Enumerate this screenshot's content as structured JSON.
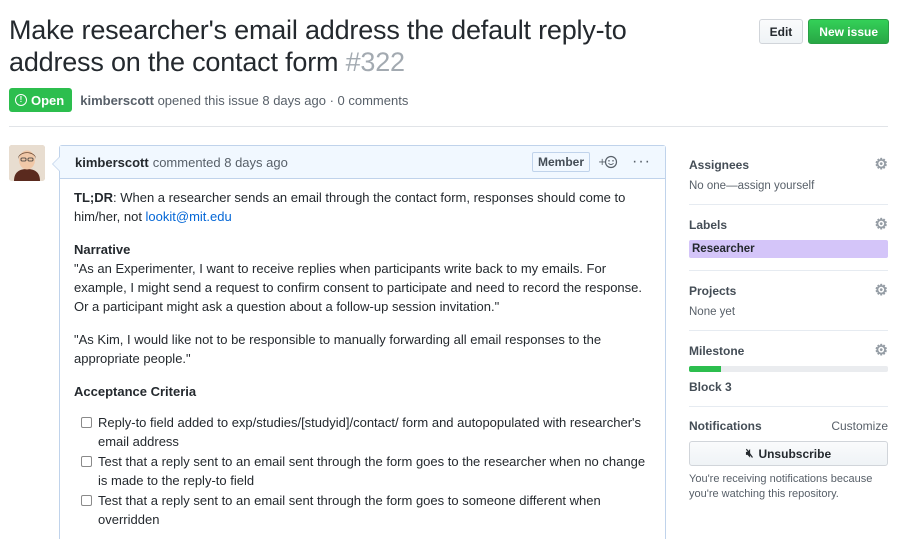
{
  "issue": {
    "title": "Make researcher's email address the default reply-to address on the contact form",
    "number": "#322",
    "state": "Open",
    "author": "kimberscott",
    "opened_text": "opened this issue 8 days ago · 0 comments"
  },
  "header_actions": {
    "edit_label": "Edit",
    "new_issue_label": "New issue"
  },
  "comment": {
    "author": "kimberscott",
    "action": "commented 8 days ago",
    "role_badge": "Member",
    "reaction_icon": "smiley-plus-icon",
    "menu_icon": "kebab-horizontal-icon",
    "tldr_label": "TL;DR",
    "tldr_text": ": When a researcher sends an email through the contact form, responses should come to him/her, not ",
    "tldr_link": "lookit@mit.edu",
    "narrative_heading": "Narrative",
    "narrative_p1": "\"As an Experimenter, I want to receive replies when participants write back to my emails. For example, I might send a request to confirm consent to participate and need to record the response. Or a participant might ask a question about a follow-up session invitation.\"",
    "narrative_p2": "\"As Kim, I would like not to be responsible to manually forwarding all email responses to the appropriate people.\"",
    "acceptance_heading": "Acceptance Criteria",
    "tasks": [
      "Reply-to field added to exp/studies/[studyid]/contact/ form and autopopulated with researcher's email address",
      "Test that a reply sent to an email sent through the form goes to the researcher when no change is made to the reply-to field",
      "Test that a reply sent to an email sent through the form goes to someone different when overridden"
    ]
  },
  "sidebar": {
    "assignees": {
      "heading": "Assignees",
      "value": "No one—assign yourself"
    },
    "labels": {
      "heading": "Labels",
      "items": [
        "Researcher"
      ],
      "label_color": "#d4c5f9"
    },
    "projects": {
      "heading": "Projects",
      "value": "None yet"
    },
    "milestone": {
      "heading": "Milestone",
      "progress_fraction": 0.16,
      "name": "Block 3"
    },
    "notifications": {
      "heading": "Notifications",
      "customize": "Customize",
      "button": "Unsubscribe",
      "note": "You're receiving notifications because you're watching this repository."
    }
  },
  "colors": {
    "open_state": "#2cbe4e",
    "link": "#0366d6",
    "comment_header_bg": "#f1f8ff"
  }
}
